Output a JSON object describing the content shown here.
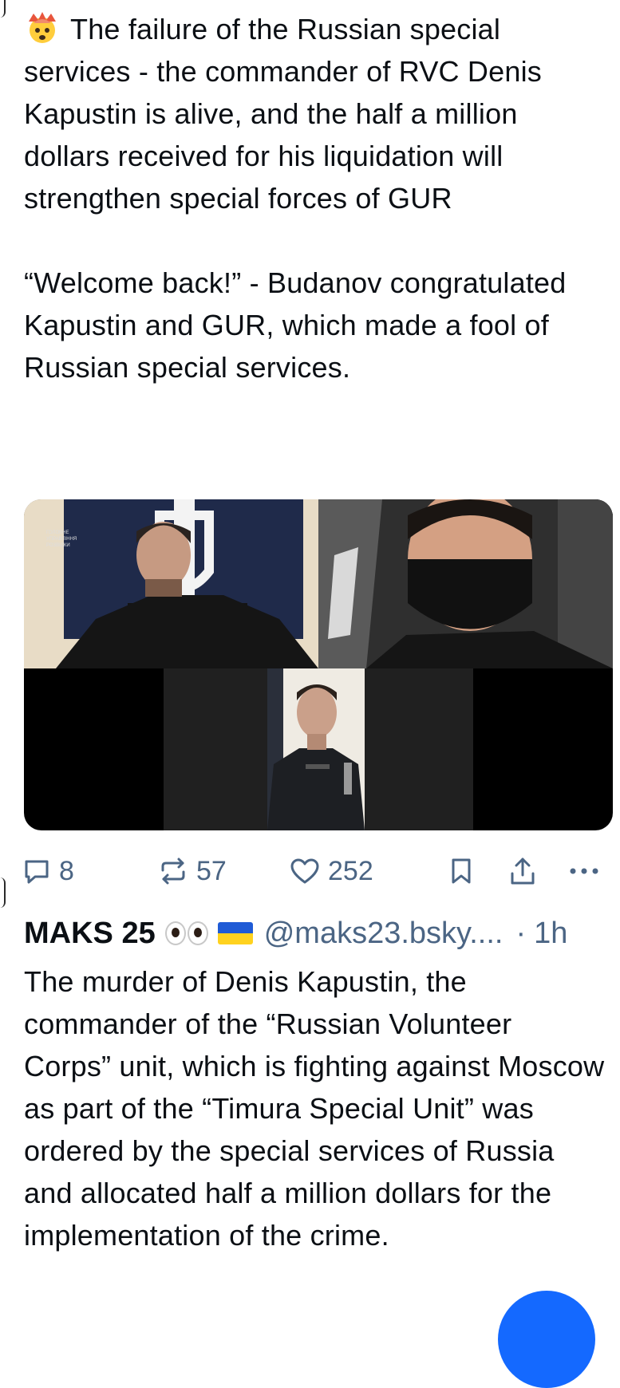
{
  "post1": {
    "emoji": "exploding-head",
    "text": "The failure of the Russian special services - the commander of RVC Denis Kapustin is alive, and the half a million dollars received for his liquidation will strengthen special forces of GUR\n\n“Welcome back!” - Budanov congratulated Kapustin and GUR, which made a fool of Russian special services.",
    "media": {
      "left_tile_logo_text": "ГОЛОВНЕ УПРАВЛІННЯ РОЗВІДКИ",
      "tiles": [
        "man-in-front-of-flag",
        "masked-man-in-car",
        "man-in-uniform"
      ]
    },
    "actions": {
      "reply_count": "8",
      "repost_count": "57",
      "like_count": "252"
    }
  },
  "post2": {
    "display_name": "MAKS 25",
    "handle": "@maks23.bsky....",
    "separator": "·",
    "time": "1h",
    "text": "The murder of Denis Kapustin, the commander of the “Russian Volunteer Corps” unit, which is fighting against Moscow as part of the “Timura Special Unit” was ordered by the special services of Russia and allocated half a million dollars for the implementation of the crime."
  },
  "colors": {
    "text": "#0b0f14",
    "muted": "#4b6584",
    "accent": "#1469ff"
  }
}
